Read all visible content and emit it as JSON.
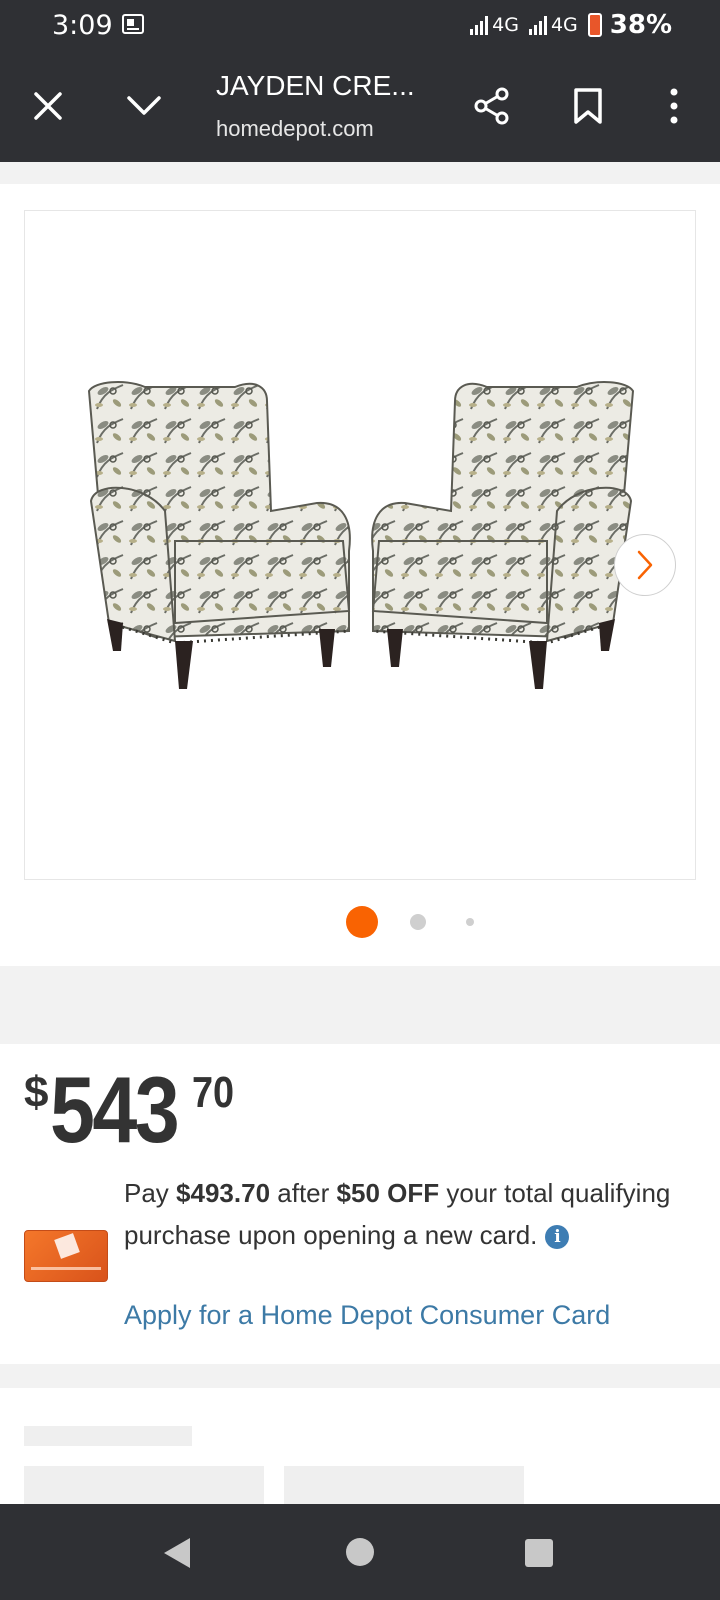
{
  "status_bar": {
    "time": "3:09",
    "network1": "4G",
    "network2": "4G",
    "battery": "38%"
  },
  "toolbar": {
    "title": "JAYDEN CRE...",
    "url": "homedepot.com",
    "icons": [
      "close-icon",
      "chevron-down-icon",
      "share-icon",
      "bookmark-icon",
      "more-vert-icon"
    ]
  },
  "gallery": {
    "image_alt": "pair of floral wingback armchairs",
    "pages": 3,
    "active_page": 1,
    "accent": "#f96302"
  },
  "price": {
    "currency": "$",
    "dollars": "543",
    "cents": "70"
  },
  "promo": {
    "text_pay": "Pay",
    "discounted_price": "$493.70",
    "text_after": "after",
    "discount": "$50 OFF",
    "text_rest": "your total qualifying purchase upon opening a new card.",
    "apply_link": "Apply for a Home Depot Consumer Card",
    "link_color": "#3d7aa6"
  }
}
